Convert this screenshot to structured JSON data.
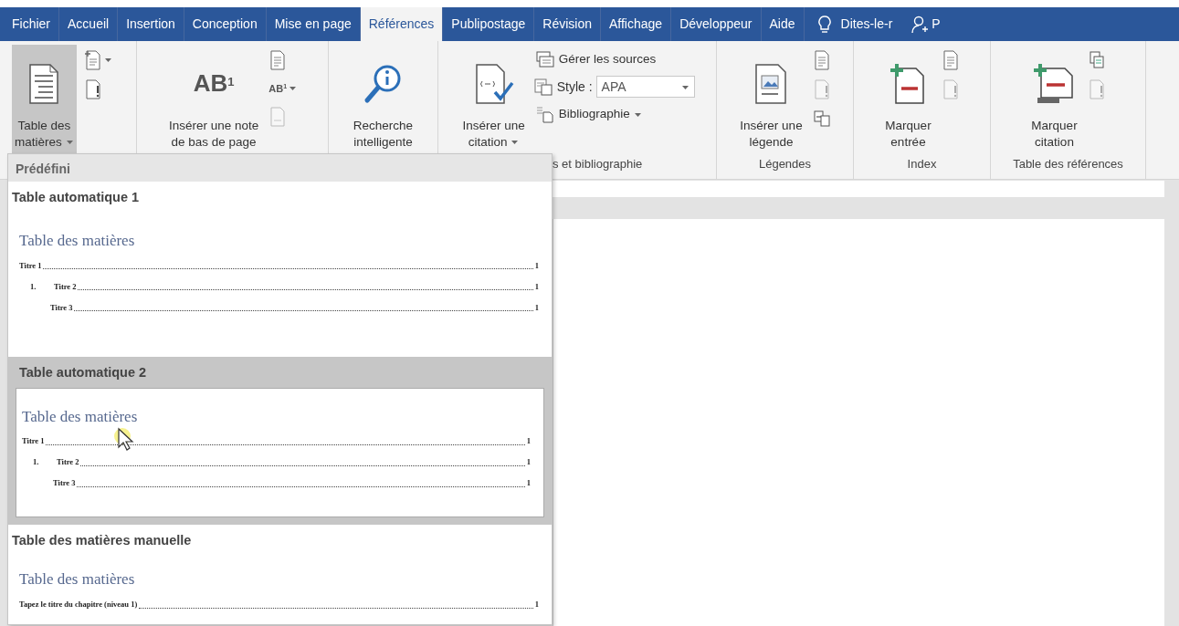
{
  "tabs": [
    {
      "label": "Fichier",
      "selected": false
    },
    {
      "label": "Accueil",
      "selected": false
    },
    {
      "label": "Insertion",
      "selected": false
    },
    {
      "label": "Conception",
      "selected": false
    },
    {
      "label": "Mise en page",
      "selected": false
    },
    {
      "label": "Références",
      "selected": true
    },
    {
      "label": "Publipostage",
      "selected": false
    },
    {
      "label": "Révision",
      "selected": false
    },
    {
      "label": "Affichage",
      "selected": false
    },
    {
      "label": "Développeur",
      "selected": false
    },
    {
      "label": "Aide",
      "selected": false
    }
  ],
  "tell_me": "Dites-le-r",
  "account": "P",
  "ribbon": {
    "groups": [
      {
        "large": [
          {
            "lines": [
              "Table des",
              "matières"
            ],
            "dropdown": true,
            "pressed": true
          }
        ],
        "small": [
          {
            "kind": "page-plus",
            "dropdown": true,
            "disabled": false
          },
          {
            "kind": "page-alert",
            "disabled": false
          }
        ]
      },
      {
        "large": [
          {
            "icon_text": "AB$^{1}$",
            "lines": [
              "Insérer une note",
              "de bas de page"
            ],
            "pressed": false
          }
        ],
        "small": [
          {
            "kind": "page-lines",
            "disabled": false
          },
          {
            "kind": "text",
            "icon_text": "AB$^{1}$",
            "dropdown": true,
            "disabled": false
          },
          {
            "kind": "page-blank",
            "disabled": true
          }
        ]
      },
      {
        "large": [
          {
            "lines": [
              "Recherche",
              "intelligente"
            ],
            "pressed": false
          }
        ]
      },
      {
        "large": [
          {
            "lines": [
              "Insérer une",
              "citation"
            ],
            "dropdown": true,
            "pressed": false
          }
        ],
        "rows": [
          {
            "kind": "manage-sources",
            "label": "Gérer les sources"
          },
          {
            "kind": "style",
            "label": "Style :",
            "value": "APA"
          },
          {
            "kind": "bibliography",
            "label": "Bibliographie",
            "dropdown": true
          }
        ],
        "label": "s et bibliographie"
      },
      {
        "large": [
          {
            "lines": [
              "Insérer une",
              "légende"
            ],
            "pressed": false
          }
        ],
        "small": [
          {
            "kind": "page-lines",
            "disabled": false
          },
          {
            "kind": "page-alert",
            "disabled": true
          },
          {
            "kind": "page-arrows",
            "disabled": false
          }
        ],
        "label": "Légendes"
      },
      {
        "large": [
          {
            "lines": [
              "Marquer",
              "entrée"
            ],
            "pressed": false
          }
        ],
        "small": [
          {
            "kind": "page-lines",
            "disabled": false
          },
          {
            "kind": "page-alert",
            "disabled": true
          }
        ],
        "label": "Index"
      },
      {
        "large": [
          {
            "lines": [
              "Marquer",
              "citation"
            ],
            "pressed": false
          }
        ],
        "small": [
          {
            "kind": "page-stack",
            "disabled": false
          },
          {
            "kind": "page-alert",
            "disabled": true
          }
        ],
        "label": "Table des références"
      }
    ]
  },
  "gallery": {
    "header": "Prédéfini",
    "items": [
      {
        "title": "Table automatique 1",
        "selected": false,
        "preview": {
          "heading": "Table des matières",
          "entries": [
            {
              "text": "Titre 1",
              "page": "1",
              "children": [
                {
                  "number": "1.",
                  "text": "Titre 2",
                  "page": "1",
                  "children": [
                    {
                      "text": "Titre 3",
                      "page": "1"
                    }
                  ]
                }
              ]
            }
          ]
        }
      },
      {
        "title": "Table automatique 2",
        "selected": true,
        "preview": {
          "heading": "Table des matières",
          "entries": [
            {
              "text": "Titre 1",
              "page": "1",
              "children": [
                {
                  "number": "1.",
                  "text": "Titre 2",
                  "page": "1",
                  "children": [
                    {
                      "text": "Titre 3",
                      "page": "1"
                    }
                  ]
                }
              ]
            }
          ]
        }
      },
      {
        "title": "Table des matières manuelle",
        "selected": false,
        "preview": {
          "heading": "Table des matières",
          "entries": [
            {
              "text": "Tapez le titre du chapitre (niveau 1)",
              "page": "1"
            }
          ]
        }
      }
    ]
  }
}
